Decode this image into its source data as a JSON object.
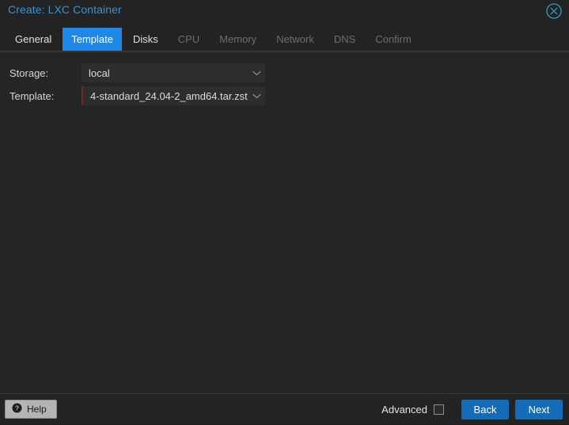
{
  "window": {
    "title": "Create: LXC Container",
    "close_icon": "close-circle-icon"
  },
  "tabs": [
    {
      "label": "General",
      "state": "enabled"
    },
    {
      "label": "Template",
      "state": "active"
    },
    {
      "label": "Disks",
      "state": "enabled"
    },
    {
      "label": "CPU",
      "state": "disabled"
    },
    {
      "label": "Memory",
      "state": "disabled"
    },
    {
      "label": "Network",
      "state": "disabled"
    },
    {
      "label": "DNS",
      "state": "disabled"
    },
    {
      "label": "Confirm",
      "state": "disabled"
    }
  ],
  "form": {
    "storage": {
      "label": "Storage:",
      "value": "local",
      "arrow_icon": "chevron-down-icon"
    },
    "template": {
      "label": "Template:",
      "value": "4-standard_24.04-2_amd64.tar.zst",
      "arrow_icon": "chevron-down-icon"
    }
  },
  "footer": {
    "help_label": "Help",
    "help_icon": "question-mark-icon",
    "advanced_label": "Advanced",
    "advanced_checked": false,
    "back_label": "Back",
    "next_label": "Next"
  },
  "colors": {
    "accent": "#1f87e8",
    "title": "#3892d4",
    "button": "#156bb5",
    "window_bg": "#232323",
    "body_bg": "#252525",
    "field_bg": "#2d2d2d"
  }
}
